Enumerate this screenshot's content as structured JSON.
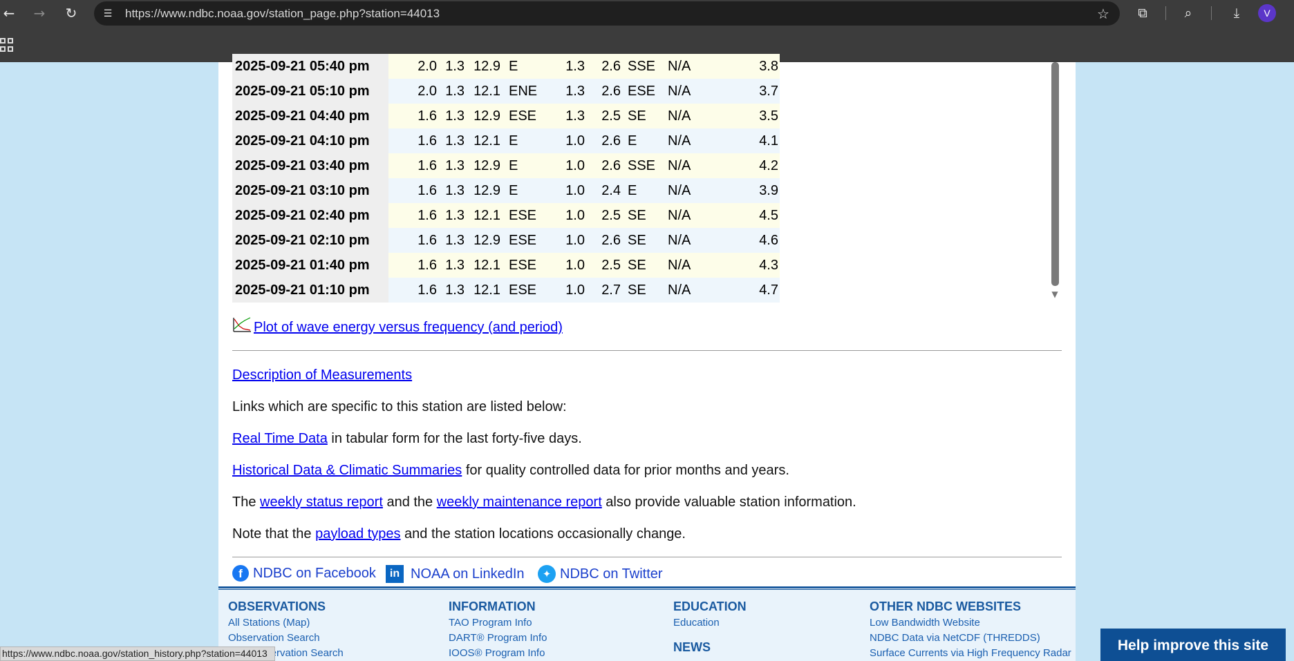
{
  "browser": {
    "url": "https://www.ndbc.noaa.gov/station_page.php?station=44013",
    "profile_initial": "V",
    "status_url": "https://www.ndbc.noaa.gov/station_history.php?station=44013"
  },
  "table": {
    "rows": [
      [
        "2025-09-21 05:40 pm",
        "2.0",
        "1.3",
        "12.9",
        "E",
        "1.3",
        "2.6",
        "SSE",
        "N/A",
        "3.8"
      ],
      [
        "2025-09-21 05:10 pm",
        "2.0",
        "1.3",
        "12.1",
        "ENE",
        "1.3",
        "2.6",
        "ESE",
        "N/A",
        "3.7"
      ],
      [
        "2025-09-21 04:40 pm",
        "1.6",
        "1.3",
        "12.9",
        "ESE",
        "1.3",
        "2.5",
        "SE",
        "N/A",
        "3.5"
      ],
      [
        "2025-09-21 04:10 pm",
        "1.6",
        "1.3",
        "12.1",
        "E",
        "1.0",
        "2.6",
        "E",
        "N/A",
        "4.1"
      ],
      [
        "2025-09-21 03:40 pm",
        "1.6",
        "1.3",
        "12.9",
        "E",
        "1.0",
        "2.6",
        "SSE",
        "N/A",
        "4.2"
      ],
      [
        "2025-09-21 03:10 pm",
        "1.6",
        "1.3",
        "12.9",
        "E",
        "1.0",
        "2.4",
        "E",
        "N/A",
        "3.9"
      ],
      [
        "2025-09-21 02:40 pm",
        "1.6",
        "1.3",
        "12.1",
        "ESE",
        "1.0",
        "2.5",
        "SE",
        "N/A",
        "4.5"
      ],
      [
        "2025-09-21 02:10 pm",
        "1.6",
        "1.3",
        "12.9",
        "ESE",
        "1.0",
        "2.6",
        "SE",
        "N/A",
        "4.6"
      ],
      [
        "2025-09-21 01:40 pm",
        "1.6",
        "1.3",
        "12.1",
        "ESE",
        "1.0",
        "2.5",
        "SE",
        "N/A",
        "4.3"
      ],
      [
        "2025-09-21 01:10 pm",
        "1.6",
        "1.3",
        "12.1",
        "ESE",
        "1.0",
        "2.7",
        "SE",
        "N/A",
        "4.7"
      ]
    ]
  },
  "plot_link": "Plot of wave energy versus frequency (and period)",
  "links": {
    "description": "Description of Measurements",
    "intro": "Links which are specific to this station are listed below:",
    "realtime": "Real Time Data",
    "realtime_suffix": " in tabular form for the last forty-five days.",
    "historical": "Historical Data & Climatic Summaries",
    "historical_suffix": " for quality controlled data for prior months and years.",
    "weekly_prefix": "The ",
    "weekly_status": "weekly status report",
    "weekly_mid": " and the ",
    "weekly_maintenance": "weekly maintenance report",
    "weekly_suffix": " also provide valuable station information.",
    "note_prefix": "Note that the ",
    "payload": "payload types",
    "note_suffix": " and the station locations occasionally change."
  },
  "social": {
    "facebook": "NDBC on Facebook",
    "linkedin": "NOAA on LinkedIn",
    "twitter": "NDBC on Twitter"
  },
  "footer": {
    "observations": {
      "heading": "OBSERVATIONS",
      "items": [
        "All Stations (Map)",
        "Observation Search",
        "Ship Observation Search"
      ]
    },
    "information": {
      "heading": "INFORMATION",
      "items": [
        "TAO Program Info",
        "DART® Program Info",
        "IOOS® Program Info"
      ]
    },
    "education": {
      "heading": "EDUCATION",
      "items": [
        "Education"
      ]
    },
    "news": {
      "heading": "NEWS"
    },
    "other": {
      "heading": "OTHER NDBC WEBSITES",
      "items": [
        "Low Bandwidth Website",
        "NDBC Data via NetCDF (THREDDS)",
        "Surface Currents via High Frequency Radar"
      ]
    }
  },
  "help_button": "Help improve this site",
  "colors": {
    "link": "#0000ee",
    "footer_heading": "#1a5aa0",
    "help_button": "#0e4f94"
  }
}
